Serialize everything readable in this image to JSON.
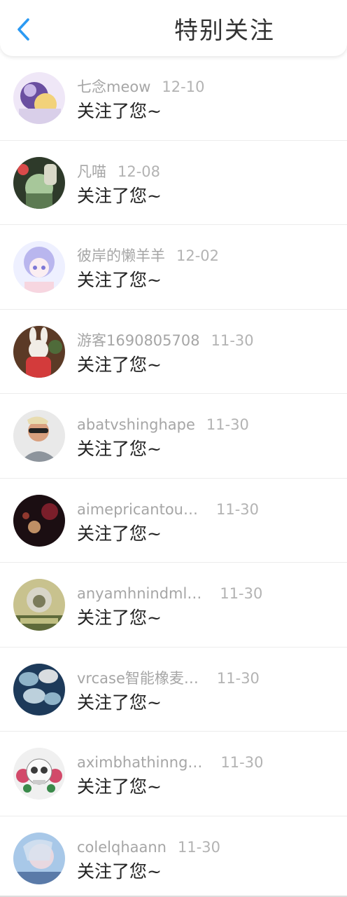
{
  "header": {
    "title": "特别关注",
    "back_icon": "chevron-left-icon",
    "accent_color": "#2b9af3"
  },
  "notifications": [
    {
      "name": "七念meow",
      "date": "12-10",
      "message": "关注了您~",
      "avatar_colors": [
        "#c9b8e8",
        "#6a4fa0",
        "#f2d27a"
      ]
    },
    {
      "name": "凡喵",
      "date": "12-08",
      "message": "关注了您~",
      "avatar_colors": [
        "#2e3a2a",
        "#a7c79a",
        "#d94a4a"
      ]
    },
    {
      "name": "彼岸的懒羊羊",
      "date": "12-02",
      "message": "关注了您~",
      "avatar_colors": [
        "#eef0ff",
        "#b9b6ee",
        "#f7d6e0"
      ]
    },
    {
      "name": "游客1690805708",
      "date": "11-30",
      "message": "关注了您~",
      "avatar_colors": [
        "#5b3a26",
        "#f1ede6",
        "#d33b3b"
      ]
    },
    {
      "name": "abatvshinghape",
      "date": "11-30",
      "message": "关注了您~",
      "avatar_colors": [
        "#e9e9e9",
        "#d9a07f",
        "#222222"
      ]
    },
    {
      "name": "aimepricantou…",
      "date": "11-30",
      "message": "关注了您~",
      "avatar_colors": [
        "#1b0e12",
        "#7a1e2a",
        "#e8b07a"
      ]
    },
    {
      "name": "anyamhnindml…",
      "date": "11-30",
      "message": "关注了您~",
      "avatar_colors": [
        "#c8c28e",
        "#7b7b5a",
        "#d8d5c8"
      ]
    },
    {
      "name": "vrcase智能橡麦…",
      "date": "11-30",
      "message": "关注了您~",
      "avatar_colors": [
        "#1d3a5a",
        "#8fb3c8",
        "#d9dde0"
      ]
    },
    {
      "name": "aximbhathinng…",
      "date": "11-30",
      "message": "关注了您~",
      "avatar_colors": [
        "#f0f0f0",
        "#d24a6a",
        "#3a8a4a"
      ]
    },
    {
      "name": "colelqhaann",
      "date": "11-30",
      "message": "关注了您~",
      "avatar_colors": [
        "#a8c8e8",
        "#e8d8e0",
        "#5a7aa8"
      ]
    }
  ]
}
